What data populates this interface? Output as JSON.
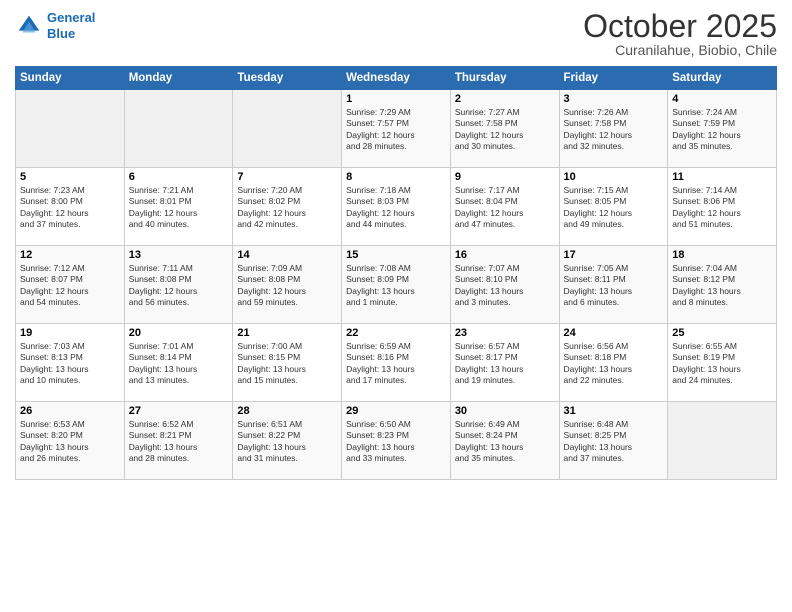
{
  "header": {
    "logo_line1": "General",
    "logo_line2": "Blue",
    "month": "October 2025",
    "location": "Curanilahue, Biobio, Chile"
  },
  "days_of_week": [
    "Sunday",
    "Monday",
    "Tuesday",
    "Wednesday",
    "Thursday",
    "Friday",
    "Saturday"
  ],
  "weeks": [
    [
      {
        "day": "",
        "info": ""
      },
      {
        "day": "",
        "info": ""
      },
      {
        "day": "",
        "info": ""
      },
      {
        "day": "1",
        "info": "Sunrise: 7:29 AM\nSunset: 7:57 PM\nDaylight: 12 hours\nand 28 minutes."
      },
      {
        "day": "2",
        "info": "Sunrise: 7:27 AM\nSunset: 7:58 PM\nDaylight: 12 hours\nand 30 minutes."
      },
      {
        "day": "3",
        "info": "Sunrise: 7:26 AM\nSunset: 7:58 PM\nDaylight: 12 hours\nand 32 minutes."
      },
      {
        "day": "4",
        "info": "Sunrise: 7:24 AM\nSunset: 7:59 PM\nDaylight: 12 hours\nand 35 minutes."
      }
    ],
    [
      {
        "day": "5",
        "info": "Sunrise: 7:23 AM\nSunset: 8:00 PM\nDaylight: 12 hours\nand 37 minutes."
      },
      {
        "day": "6",
        "info": "Sunrise: 7:21 AM\nSunset: 8:01 PM\nDaylight: 12 hours\nand 40 minutes."
      },
      {
        "day": "7",
        "info": "Sunrise: 7:20 AM\nSunset: 8:02 PM\nDaylight: 12 hours\nand 42 minutes."
      },
      {
        "day": "8",
        "info": "Sunrise: 7:18 AM\nSunset: 8:03 PM\nDaylight: 12 hours\nand 44 minutes."
      },
      {
        "day": "9",
        "info": "Sunrise: 7:17 AM\nSunset: 8:04 PM\nDaylight: 12 hours\nand 47 minutes."
      },
      {
        "day": "10",
        "info": "Sunrise: 7:15 AM\nSunset: 8:05 PM\nDaylight: 12 hours\nand 49 minutes."
      },
      {
        "day": "11",
        "info": "Sunrise: 7:14 AM\nSunset: 8:06 PM\nDaylight: 12 hours\nand 51 minutes."
      }
    ],
    [
      {
        "day": "12",
        "info": "Sunrise: 7:12 AM\nSunset: 8:07 PM\nDaylight: 12 hours\nand 54 minutes."
      },
      {
        "day": "13",
        "info": "Sunrise: 7:11 AM\nSunset: 8:08 PM\nDaylight: 12 hours\nand 56 minutes."
      },
      {
        "day": "14",
        "info": "Sunrise: 7:09 AM\nSunset: 8:08 PM\nDaylight: 12 hours\nand 59 minutes."
      },
      {
        "day": "15",
        "info": "Sunrise: 7:08 AM\nSunset: 8:09 PM\nDaylight: 13 hours\nand 1 minute."
      },
      {
        "day": "16",
        "info": "Sunrise: 7:07 AM\nSunset: 8:10 PM\nDaylight: 13 hours\nand 3 minutes."
      },
      {
        "day": "17",
        "info": "Sunrise: 7:05 AM\nSunset: 8:11 PM\nDaylight: 13 hours\nand 6 minutes."
      },
      {
        "day": "18",
        "info": "Sunrise: 7:04 AM\nSunset: 8:12 PM\nDaylight: 13 hours\nand 8 minutes."
      }
    ],
    [
      {
        "day": "19",
        "info": "Sunrise: 7:03 AM\nSunset: 8:13 PM\nDaylight: 13 hours\nand 10 minutes."
      },
      {
        "day": "20",
        "info": "Sunrise: 7:01 AM\nSunset: 8:14 PM\nDaylight: 13 hours\nand 13 minutes."
      },
      {
        "day": "21",
        "info": "Sunrise: 7:00 AM\nSunset: 8:15 PM\nDaylight: 13 hours\nand 15 minutes."
      },
      {
        "day": "22",
        "info": "Sunrise: 6:59 AM\nSunset: 8:16 PM\nDaylight: 13 hours\nand 17 minutes."
      },
      {
        "day": "23",
        "info": "Sunrise: 6:57 AM\nSunset: 8:17 PM\nDaylight: 13 hours\nand 19 minutes."
      },
      {
        "day": "24",
        "info": "Sunrise: 6:56 AM\nSunset: 8:18 PM\nDaylight: 13 hours\nand 22 minutes."
      },
      {
        "day": "25",
        "info": "Sunrise: 6:55 AM\nSunset: 8:19 PM\nDaylight: 13 hours\nand 24 minutes."
      }
    ],
    [
      {
        "day": "26",
        "info": "Sunrise: 6:53 AM\nSunset: 8:20 PM\nDaylight: 13 hours\nand 26 minutes."
      },
      {
        "day": "27",
        "info": "Sunrise: 6:52 AM\nSunset: 8:21 PM\nDaylight: 13 hours\nand 28 minutes."
      },
      {
        "day": "28",
        "info": "Sunrise: 6:51 AM\nSunset: 8:22 PM\nDaylight: 13 hours\nand 31 minutes."
      },
      {
        "day": "29",
        "info": "Sunrise: 6:50 AM\nSunset: 8:23 PM\nDaylight: 13 hours\nand 33 minutes."
      },
      {
        "day": "30",
        "info": "Sunrise: 6:49 AM\nSunset: 8:24 PM\nDaylight: 13 hours\nand 35 minutes."
      },
      {
        "day": "31",
        "info": "Sunrise: 6:48 AM\nSunset: 8:25 PM\nDaylight: 13 hours\nand 37 minutes."
      },
      {
        "day": "",
        "info": ""
      }
    ]
  ]
}
